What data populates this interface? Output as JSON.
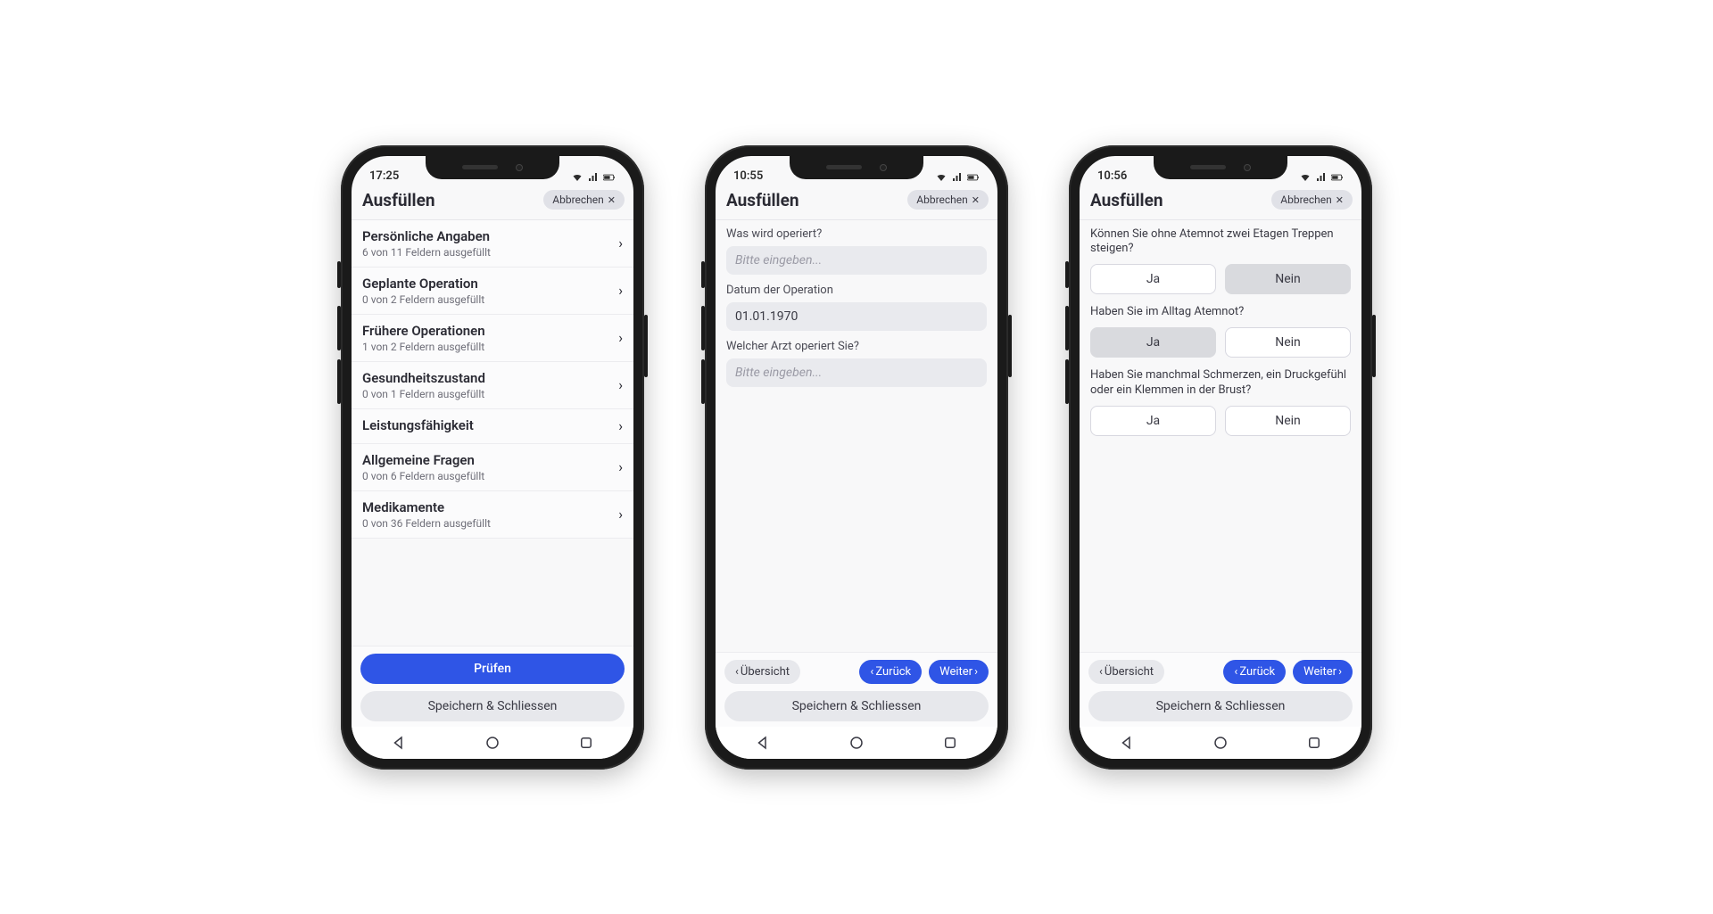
{
  "colors": {
    "accent": "#2f55e6",
    "bg": "#f8f8f9",
    "pill": "#e0e1e7"
  },
  "common": {
    "page_title": "Ausfüllen",
    "cancel_label": "Abbrechen",
    "save_close_label": "Speichern & Schliessen",
    "overview_label": "Übersicht",
    "back_label": "Zurück",
    "next_label": "Weiter",
    "check_label": "Prüfen",
    "yes": "Ja",
    "no": "Nein"
  },
  "phone1": {
    "time": "17:25",
    "sections": [
      {
        "title": "Persönliche Angaben",
        "sub": "6 von 11 Feldern ausgefüllt"
      },
      {
        "title": "Geplante Operation",
        "sub": "0 von 2 Feldern ausgefüllt"
      },
      {
        "title": "Frühere Operationen",
        "sub": "1 von 2 Feldern ausgefüllt"
      },
      {
        "title": "Gesundheitszustand",
        "sub": "0 von 1 Feldern ausgefüllt"
      },
      {
        "title": "Leistungsfähigkeit",
        "sub": ""
      },
      {
        "title": "Allgemeine Fragen",
        "sub": "0 von 6 Feldern ausgefüllt"
      },
      {
        "title": "Medikamente",
        "sub": "0 von 36 Feldern ausgefüllt"
      }
    ]
  },
  "phone2": {
    "time": "10:55",
    "fields": {
      "f1_label": "Was wird operiert?",
      "f1_placeholder": "Bitte eingeben...",
      "f2_label": "Datum der Operation",
      "f2_value": "01.01.1970",
      "f3_label": "Welcher Arzt operiert Sie?",
      "f3_placeholder": "Bitte eingeben..."
    }
  },
  "phone3": {
    "time": "10:56",
    "questions": {
      "q1": "Können Sie ohne Atemnot zwei Etagen Treppen steigen?",
      "q1_selected": "no",
      "q2": "Haben Sie im Alltag Atemnot?",
      "q2_selected": "yes",
      "q3": "Haben Sie manchmal Schmerzen, ein Druckgefühl oder ein Klemmen in der Brust?",
      "q3_selected": ""
    }
  }
}
